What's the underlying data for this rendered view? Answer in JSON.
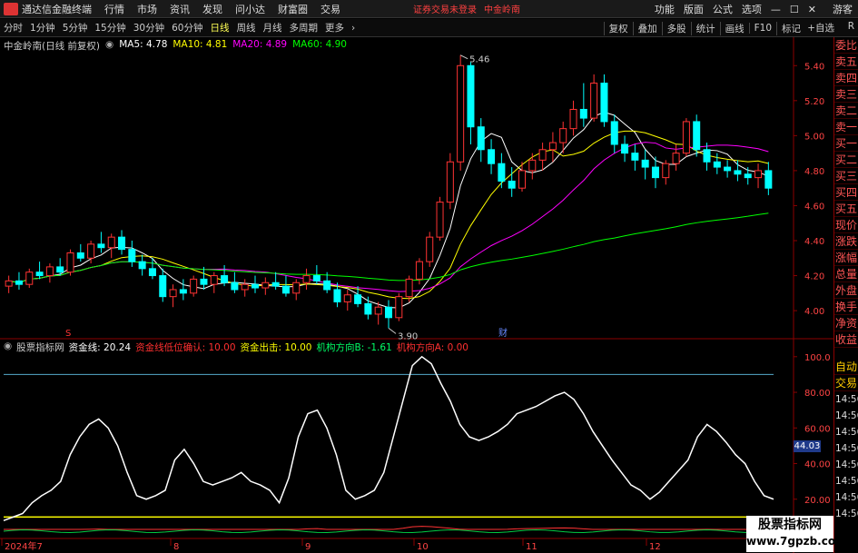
{
  "menubar": {
    "app_title": "通达信金融终端",
    "items": [
      "行情",
      "市场",
      "资讯",
      "发现",
      "问小达",
      "财富圈",
      "交易"
    ],
    "warning": "证券交易未登录",
    "stock_name": "中金岭南",
    "right_items": [
      "功能",
      "版面",
      "公式",
      "选项"
    ],
    "guest": "游客"
  },
  "toolbar": {
    "periods": [
      "分时",
      "1分钟",
      "5分钟",
      "15分钟",
      "30分钟",
      "60分钟",
      "日线",
      "周线",
      "月线",
      "多周期",
      "更多"
    ],
    "active_period": "日线",
    "right_tools": [
      "复权",
      "叠加",
      "多股",
      "统计",
      "画线",
      "F10",
      "标记"
    ],
    "zixuan": "+自选",
    "right_arrow": "R"
  },
  "main_legend": {
    "title": "中金岭南(日线 前复权)",
    "ma5": "MA5: 4.78",
    "ma10": "MA10: 4.81",
    "ma20": "MA20: 4.89",
    "ma60": "MA60: 4.90",
    "colors": {
      "ma5": "#ffffff",
      "ma10": "#ffff00",
      "ma20": "#ff00ff",
      "ma60": "#00ff00"
    }
  },
  "price_axis": [
    "5.40",
    "5.20",
    "5.00",
    "4.80",
    "4.60",
    "4.40",
    "4.20",
    "4.00"
  ],
  "annotations": {
    "high": "5.46",
    "low": "3.90",
    "marker_s": "S",
    "marker_cai": "财"
  },
  "ind_legend": {
    "name": "股票指标网",
    "zjx": "资金线: 20.24",
    "dwqr": "资金线低位确认: 10.00",
    "zjcj": "资金出击: 10.00",
    "jgb": "机构方向B: -1.61",
    "jga": "机构方向A: 0.00"
  },
  "ind_axis": [
    "100.0",
    "80.00",
    "60.00",
    "40.00",
    "20.00"
  ],
  "cur_value": "44.03",
  "date_axis": [
    "2024年7",
    "8",
    "9",
    "10",
    "11",
    "12"
  ],
  "sidebar": {
    "quote_items": [
      "委比",
      "卖五",
      "卖四",
      "卖三",
      "卖二",
      "卖一",
      "买一",
      "买二",
      "买三",
      "买四",
      "买五",
      "现价",
      "涨跌",
      "涨幅",
      "总量",
      "外盘",
      "换手",
      "净资",
      "收益"
    ],
    "panel_items": [
      "自动",
      "交易"
    ],
    "times": [
      "14:56",
      "14:56",
      "14:56",
      "14:56",
      "14:56",
      "14:56",
      "14:56",
      "14:56"
    ]
  },
  "watermark": {
    "line1": "股票指标网",
    "line2": "www.7gpzb.com"
  },
  "chart_data": [
    {
      "type": "candlestick",
      "title": "中金岭南(日线 前复权)",
      "ylim": [
        3.85,
        5.5
      ],
      "x_range": [
        "2024-07",
        "2024-12"
      ],
      "candles_ohlc": [
        [
          4.14,
          4.2,
          4.1,
          4.17
        ],
        [
          4.17,
          4.22,
          4.12,
          4.15
        ],
        [
          4.15,
          4.24,
          4.13,
          4.22
        ],
        [
          4.22,
          4.28,
          4.18,
          4.2
        ],
        [
          4.2,
          4.27,
          4.16,
          4.25
        ],
        [
          4.25,
          4.3,
          4.2,
          4.22
        ],
        [
          4.22,
          4.35,
          4.2,
          4.33
        ],
        [
          4.33,
          4.38,
          4.28,
          4.3
        ],
        [
          4.3,
          4.4,
          4.27,
          4.38
        ],
        [
          4.38,
          4.45,
          4.33,
          4.36
        ],
        [
          4.36,
          4.44,
          4.3,
          4.42
        ],
        [
          4.42,
          4.46,
          4.32,
          4.35
        ],
        [
          4.35,
          4.4,
          4.25,
          4.28
        ],
        [
          4.28,
          4.32,
          4.2,
          4.24
        ],
        [
          4.24,
          4.3,
          4.18,
          4.2
        ],
        [
          4.2,
          4.24,
          4.05,
          4.08
        ],
        [
          4.08,
          4.15,
          4.02,
          4.12
        ],
        [
          4.12,
          4.18,
          4.06,
          4.1
        ],
        [
          4.1,
          4.2,
          4.08,
          4.18
        ],
        [
          4.18,
          4.25,
          4.12,
          4.15
        ],
        [
          4.15,
          4.22,
          4.1,
          4.2
        ],
        [
          4.2,
          4.26,
          4.14,
          4.16
        ],
        [
          4.16,
          4.22,
          4.1,
          4.12
        ],
        [
          4.12,
          4.18,
          4.08,
          4.15
        ],
        [
          4.15,
          4.2,
          4.1,
          4.13
        ],
        [
          4.13,
          4.19,
          4.09,
          4.16
        ],
        [
          4.16,
          4.22,
          4.12,
          4.14
        ],
        [
          4.14,
          4.2,
          4.08,
          4.1
        ],
        [
          4.1,
          4.18,
          4.06,
          4.16
        ],
        [
          4.16,
          4.24,
          4.12,
          4.2
        ],
        [
          4.2,
          4.26,
          4.15,
          4.17
        ],
        [
          4.17,
          4.22,
          4.1,
          4.12
        ],
        [
          4.12,
          4.16,
          4.02,
          4.05
        ],
        [
          4.05,
          4.12,
          4.0,
          4.09
        ],
        [
          4.09,
          4.14,
          4.02,
          4.04
        ],
        [
          4.04,
          4.08,
          3.95,
          3.98
        ],
        [
          3.98,
          4.05,
          3.92,
          4.02
        ],
        [
          4.02,
          4.06,
          3.9,
          3.96
        ],
        [
          3.96,
          4.1,
          3.94,
          4.08
        ],
        [
          4.08,
          4.2,
          4.05,
          4.18
        ],
        [
          4.18,
          4.3,
          4.15,
          4.28
        ],
        [
          4.28,
          4.45,
          4.25,
          4.42
        ],
        [
          4.42,
          4.65,
          4.4,
          4.62
        ],
        [
          4.62,
          4.9,
          4.58,
          4.85
        ],
        [
          4.85,
          5.46,
          4.8,
          5.4
        ],
        [
          5.4,
          5.42,
          4.95,
          5.05
        ],
        [
          5.05,
          5.1,
          4.85,
          4.92
        ],
        [
          4.92,
          4.98,
          4.78,
          4.84
        ],
        [
          4.84,
          4.9,
          4.7,
          4.74
        ],
        [
          4.74,
          4.82,
          4.65,
          4.7
        ],
        [
          4.7,
          4.85,
          4.68,
          4.8
        ],
        [
          4.8,
          4.9,
          4.75,
          4.86
        ],
        [
          4.86,
          4.96,
          4.8,
          4.92
        ],
        [
          4.92,
          5.02,
          4.85,
          4.96
        ],
        [
          4.96,
          5.08,
          4.9,
          5.04
        ],
        [
          5.04,
          5.2,
          5.0,
          5.15
        ],
        [
          5.15,
          5.3,
          5.05,
          5.1
        ],
        [
          5.1,
          5.35,
          5.08,
          5.3
        ],
        [
          5.3,
          5.35,
          5.05,
          5.08
        ],
        [
          5.08,
          5.12,
          4.9,
          4.95
        ],
        [
          4.95,
          5.0,
          4.85,
          4.9
        ],
        [
          4.9,
          4.95,
          4.8,
          4.86
        ],
        [
          4.86,
          4.92,
          4.75,
          4.82
        ],
        [
          4.82,
          4.88,
          4.7,
          4.76
        ],
        [
          4.76,
          4.86,
          4.72,
          4.84
        ],
        [
          4.84,
          4.95,
          4.8,
          4.9
        ],
        [
          4.9,
          5.1,
          4.88,
          5.08
        ],
        [
          5.08,
          5.12,
          4.88,
          4.92
        ],
        [
          4.92,
          4.96,
          4.8,
          4.85
        ],
        [
          4.85,
          4.9,
          4.78,
          4.82
        ],
        [
          4.82,
          4.86,
          4.76,
          4.8
        ],
        [
          4.8,
          4.86,
          4.74,
          4.78
        ],
        [
          4.78,
          4.82,
          4.72,
          4.76
        ],
        [
          4.76,
          4.84,
          4.7,
          4.8
        ],
        [
          4.8,
          4.85,
          4.66,
          4.7
        ]
      ],
      "ma_colors": [
        "#ffffff",
        "#ffff00",
        "#ff00ff",
        "#00ff00"
      ],
      "ma_names": [
        "MA5",
        "MA10",
        "MA20",
        "MA60"
      ]
    },
    {
      "type": "line",
      "title": "股票指标网",
      "ylim": [
        0,
        105
      ],
      "series": [
        {
          "name": "资金线",
          "color": "#ffffff",
          "values": [
            8,
            10,
            12,
            18,
            22,
            25,
            30,
            45,
            55,
            62,
            65,
            60,
            50,
            35,
            22,
            20,
            22,
            25,
            42,
            48,
            40,
            30,
            28,
            30,
            32,
            35,
            30,
            28,
            25,
            18,
            32,
            55,
            68,
            70,
            60,
            45,
            25,
            20,
            22,
            25,
            35,
            55,
            75,
            95,
            100,
            96,
            85,
            75,
            62,
            55,
            53,
            55,
            58,
            62,
            68,
            70,
            72,
            75,
            78,
            80,
            76,
            68,
            58,
            50,
            42,
            35,
            28,
            25,
            20,
            24,
            30,
            36,
            42,
            55,
            62,
            58,
            52,
            45,
            40,
            30,
            22,
            20
          ]
        },
        {
          "name": "资金线低位确认",
          "color": "#ffff00",
          "values": [
            10,
            10
          ]
        },
        {
          "name": "资金出击",
          "color": "#ffff00",
          "values": [
            10,
            10
          ]
        }
      ],
      "reference_line": 90
    }
  ]
}
